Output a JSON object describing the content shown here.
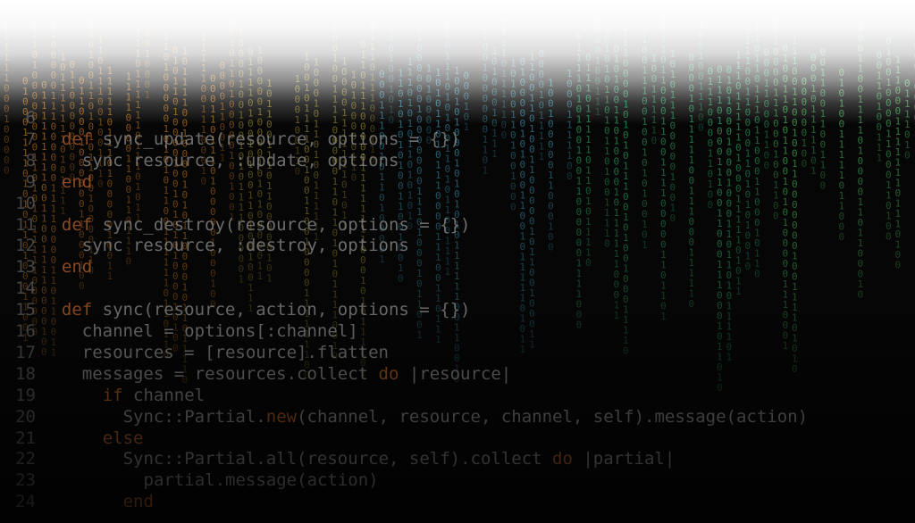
{
  "background": {
    "base_color": "#060606",
    "rain_colors": [
      "#c4781f",
      "#9a8a2a",
      "#3a90a8",
      "#2fb36a",
      "#4cc060"
    ],
    "rain_glyphs": [
      "0",
      "1"
    ]
  },
  "code": {
    "lines": [
      {
        "number": "6",
        "indent": "",
        "segments": [
          {
            "text": ""
          }
        ]
      },
      {
        "number": "7",
        "indent": "  ",
        "segments": [
          {
            "text": "def",
            "kw": true
          },
          {
            "text": " sync_update(resource, options = {})"
          }
        ]
      },
      {
        "number": "8",
        "indent": "    ",
        "segments": [
          {
            "text": "sync resource, :update, options"
          }
        ]
      },
      {
        "number": "9",
        "indent": "  ",
        "segments": [
          {
            "text": "end",
            "kw": true
          }
        ]
      },
      {
        "number": "10",
        "indent": "",
        "segments": [
          {
            "text": ""
          }
        ]
      },
      {
        "number": "11",
        "indent": "  ",
        "segments": [
          {
            "text": "def",
            "kw": true
          },
          {
            "text": " sync_destroy(resource, options = {})"
          }
        ]
      },
      {
        "number": "12",
        "indent": "    ",
        "segments": [
          {
            "text": "sync resource, :destroy, options"
          }
        ]
      },
      {
        "number": "13",
        "indent": "  ",
        "segments": [
          {
            "text": "end",
            "kw": true
          }
        ]
      },
      {
        "number": "14",
        "indent": "",
        "segments": [
          {
            "text": ""
          }
        ]
      },
      {
        "number": "15",
        "indent": "  ",
        "segments": [
          {
            "text": "def",
            "kw": true
          },
          {
            "text": " sync(resource, action, options = {})"
          }
        ]
      },
      {
        "number": "16",
        "indent": "    ",
        "segments": [
          {
            "text": "channel = options[:channel]"
          }
        ]
      },
      {
        "number": "17",
        "indent": "    ",
        "segments": [
          {
            "text": "resources = [resource].flatten"
          }
        ]
      },
      {
        "number": "18",
        "indent": "    ",
        "segments": [
          {
            "text": "messages = resources.collect "
          },
          {
            "text": "do",
            "kw": true
          },
          {
            "text": " |resource|"
          }
        ]
      },
      {
        "number": "19",
        "indent": "      ",
        "segments": [
          {
            "text": "if",
            "kw": true
          },
          {
            "text": " channel"
          }
        ]
      },
      {
        "number": "20",
        "indent": "        ",
        "segments": [
          {
            "text": "Sync::Partial."
          },
          {
            "text": "new",
            "kw": true
          },
          {
            "text": "(channel, resource, channel, self).message(action)"
          }
        ]
      },
      {
        "number": "21",
        "indent": "      ",
        "segments": [
          {
            "text": "else",
            "kw": true
          }
        ]
      },
      {
        "number": "22",
        "indent": "        ",
        "segments": [
          {
            "text": "Sync::Partial.all(resource, self).collect "
          },
          {
            "text": "do",
            "kw": true
          },
          {
            "text": " |partial|"
          }
        ]
      },
      {
        "number": "23",
        "indent": "          ",
        "segments": [
          {
            "text": "partial.message(action)"
          }
        ]
      },
      {
        "number": "24",
        "indent": "        ",
        "segments": [
          {
            "text": "end",
            "kw": true
          }
        ]
      }
    ]
  }
}
